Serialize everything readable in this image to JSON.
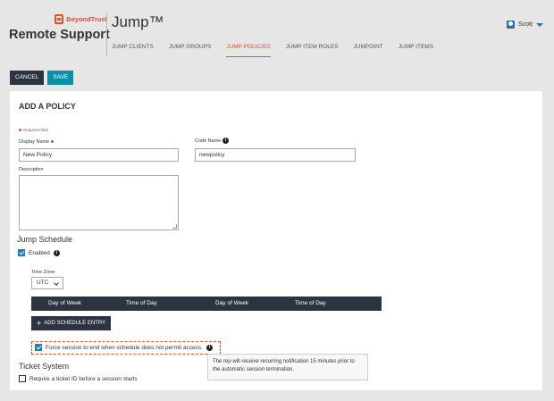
{
  "brand": {
    "company": "BeyondTrust",
    "product": "Remote Support"
  },
  "header": {
    "title": "Jump™"
  },
  "nav": {
    "items": [
      {
        "label": "JUMP CLIENTS"
      },
      {
        "label": "JUMP GROUPS"
      },
      {
        "label": "JUMP POLICIES",
        "active": true
      },
      {
        "label": "JUMP ITEM ROLES"
      },
      {
        "label": "JUMPOINT"
      },
      {
        "label": "JUMP ITEMS"
      }
    ]
  },
  "user": {
    "name": "Scott",
    "icon": "user-icon"
  },
  "toolbar": {
    "cancel_label": "CANCEL",
    "save_label": "SAVE"
  },
  "form": {
    "title": "ADD A POLICY",
    "required_note": "Required field",
    "display_name": {
      "label": "Display Name",
      "value": "New Policy"
    },
    "code_name": {
      "label": "Code Name",
      "value": "newpolicy"
    },
    "description": {
      "label": "Description",
      "value": ""
    }
  },
  "schedule": {
    "title": "Jump Schedule",
    "enabled_label": "Enabled",
    "enabled": true,
    "timezone_label": "Time Zone:",
    "timezone_value": "UTC",
    "columns": [
      "Day of Week",
      "Time of Day",
      "Day of Week",
      "Time of Day"
    ],
    "add_entry_label": "ADD SCHEDULE ENTRY",
    "force_end_label": "Force session to end when schedule does not permit access.",
    "force_end_checked": true,
    "tooltip": "The rep will receive recurring notification 15 minutes prior to the automatic session termination."
  },
  "ticket": {
    "title": "Ticket System",
    "require_label": "Require a ticket ID before a session starts",
    "require_checked": false
  },
  "colors": {
    "accent": "#e2502c",
    "primary": "#0a8fa8",
    "dark": "#2b3440",
    "check": "#1f7dc1"
  }
}
